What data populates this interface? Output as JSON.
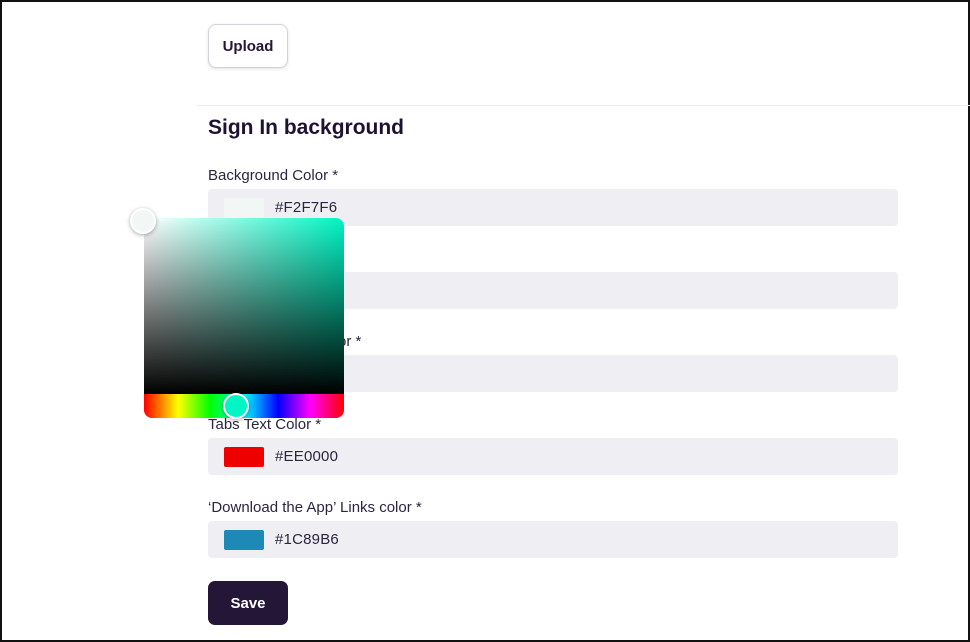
{
  "upload_button": {
    "label": "Upload"
  },
  "section": {
    "title": "Sign In background"
  },
  "fields": [
    {
      "label": "Background Color *",
      "value": "#F2F7F6",
      "swatch_color": "#F2F7F6"
    },
    {
      "label": "",
      "value": "",
      "swatch_color": ""
    },
    {
      "label": "or *",
      "value": "",
      "swatch_color": ""
    },
    {
      "label": "Tabs Text Color *",
      "value": "#EE0000",
      "swatch_color": "#EE0000"
    },
    {
      "label": "‘Download the App’ Links color *",
      "value": "#1C89B6",
      "swatch_color": "#1C89B6"
    }
  ],
  "save_button": {
    "label": "Save"
  },
  "color_picker": {
    "hue_color": "#00F5C4",
    "selected_color": "#F2F7F6"
  }
}
